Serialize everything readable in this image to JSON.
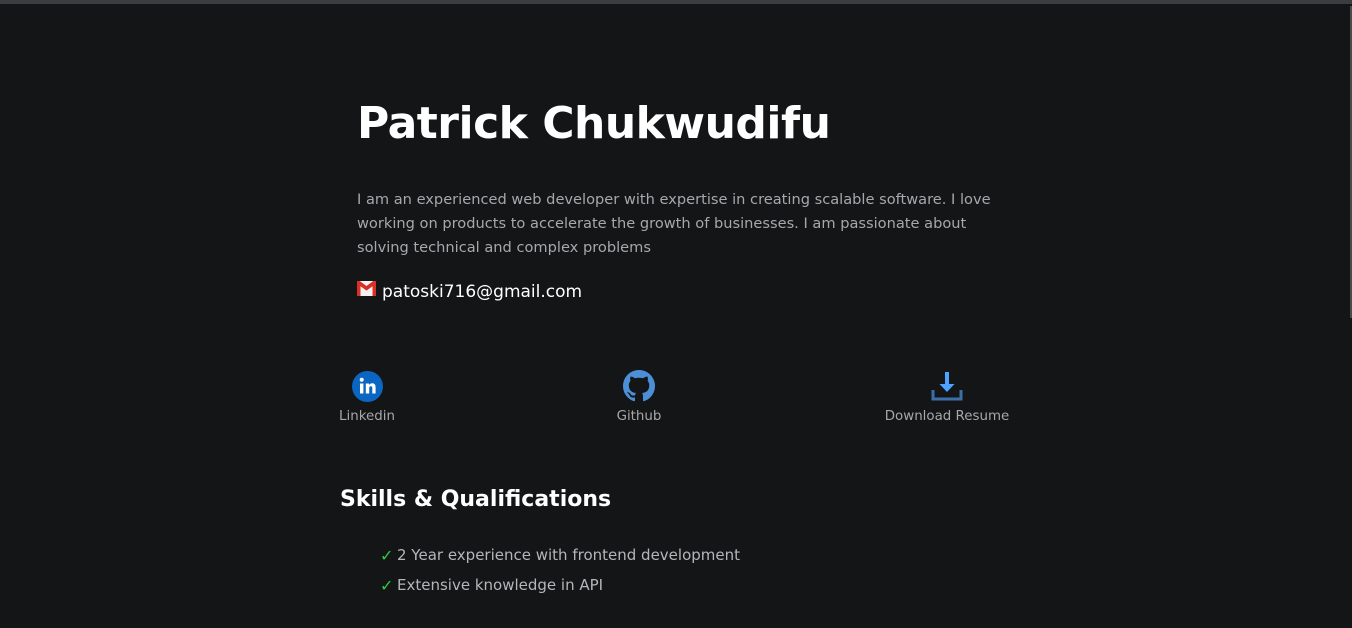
{
  "profile": {
    "name": "Patrick Chukwudifu",
    "bio": "I am an experienced web developer with expertise in creating scalable software. I love working on products to accelerate the growth of businesses. I am passionate about solving technical and complex problems",
    "email": "patoski716@gmail.com",
    "email_icon": "gmail-icon"
  },
  "links": {
    "linkedin": {
      "label": "Linkedin",
      "icon": "linkedin-icon"
    },
    "github": {
      "label": "Github",
      "icon": "github-icon"
    },
    "resume": {
      "label": "Download Resume",
      "icon": "download-icon"
    }
  },
  "skills": {
    "heading": "Skills & Qualifications",
    "check_icon": "checkmark-icon",
    "items": [
      "2 Year experience with frontend development",
      "Extensive knowledge in API"
    ]
  },
  "colors": {
    "background": "#141517",
    "heading_text": "#ffffff",
    "body_text": "#a7a8ab",
    "check_green": "#2ecc40",
    "linkedin_blue": "#0a66c2",
    "github_blue": "#4b8fd6",
    "download_blue": "#4da3ff"
  }
}
